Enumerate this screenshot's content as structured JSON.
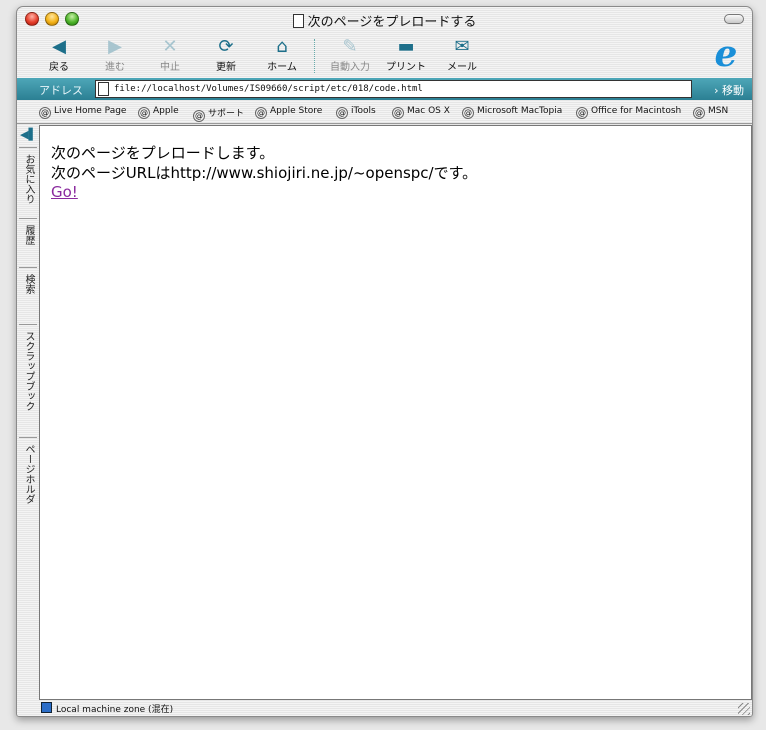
{
  "window": {
    "title": "次のページをプレロードする"
  },
  "toolbar": {
    "back": "戻る",
    "forward": "進む",
    "stop": "中止",
    "refresh": "更新",
    "home": "ホーム",
    "autofill": "自動入力",
    "print": "プリント",
    "mail": "メール"
  },
  "address": {
    "label": "アドレス",
    "url": "file://localhost/Volumes/IS09660/script/etc/018/code.html",
    "go": "移動"
  },
  "favorites": [
    "Live Home Page",
    "Apple",
    "サポート",
    "Apple Store",
    "iTools",
    "Mac OS X",
    "Microsoft MacTopia",
    "Office for Macintosh",
    "MSN"
  ],
  "side_tabs": [
    "お気に入り",
    "履歴",
    "検索",
    "スクラップブック",
    "ページホルダ"
  ],
  "content": {
    "line1": "次のページをプレロードします。",
    "line2": "次のページURLはhttp://www.shiojiri.ne.jp/~openspc/です。",
    "link": "Go!"
  },
  "status": {
    "zone": "Local machine zone (混在)"
  },
  "colors": {
    "accent": "#2b7f93",
    "link": "#8a2a9e"
  }
}
